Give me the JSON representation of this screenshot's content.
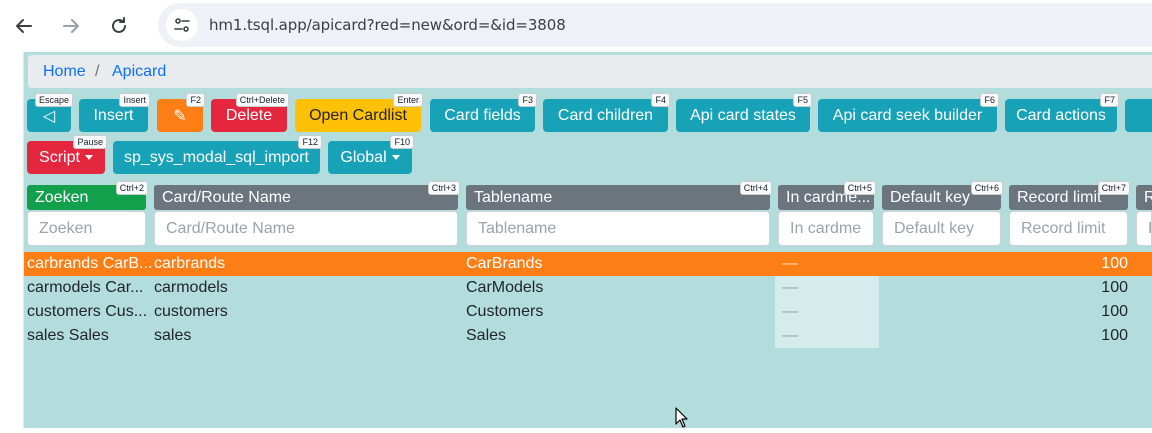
{
  "browser": {
    "url": "hm1.tsql.app/apicard?red=new&ord=&id=3808"
  },
  "breadcrumb": {
    "home": "Home",
    "separator": "/",
    "current": "Apicard"
  },
  "toolbar": {
    "back": {
      "label": "◁",
      "shortcut": "Escape"
    },
    "insert": {
      "label": "Insert",
      "shortcut": "Insert"
    },
    "edit": {
      "label": "✎",
      "shortcut": "F2"
    },
    "delete": {
      "label": "Delete",
      "shortcut": "Ctrl+Delete"
    },
    "open_cardlist": {
      "label": "Open Cardlist",
      "shortcut": "Enter"
    },
    "card_fields": {
      "label": "Card fields",
      "shortcut": "F3"
    },
    "card_children": {
      "label": "Card children",
      "shortcut": "F4"
    },
    "api_card_states": {
      "label": "Api card states",
      "shortcut": "F5"
    },
    "api_card_seek_builder": {
      "label": "Api card seek builder",
      "shortcut": "F6"
    },
    "card_actions": {
      "label": "Card actions",
      "shortcut": "F7"
    },
    "script": {
      "label": "Script",
      "shortcut": "Pause"
    },
    "sp_import": {
      "label": "sp_sys_modal_sql_import",
      "shortcut": "F12"
    },
    "global": {
      "label": "Global",
      "shortcut": "F10"
    }
  },
  "table": {
    "columns": [
      {
        "label": "Zoeken",
        "shortcut": "Ctrl+2",
        "placeholder": "Zoeken"
      },
      {
        "label": "Card/Route Name",
        "shortcut": "Ctrl+3",
        "placeholder": "Card/Route Name"
      },
      {
        "label": "Tablename",
        "shortcut": "Ctrl+4",
        "placeholder": "Tablename"
      },
      {
        "label": "In cardme...",
        "shortcut": "Ctrl+5",
        "placeholder": "In cardme"
      },
      {
        "label": "Default key",
        "shortcut": "Ctrl+6",
        "placeholder": "Default key"
      },
      {
        "label": "Record limit",
        "shortcut": "Ctrl+7",
        "placeholder": "Record limit"
      },
      {
        "label": "R",
        "shortcut": "",
        "placeholder": "R"
      }
    ],
    "rows": [
      {
        "search": "carbrands CarB...",
        "name": "carbrands",
        "table": "CarBrands",
        "in_cardmenu": "—",
        "limit": "100"
      },
      {
        "search": "carmodels Car...",
        "name": "carmodels",
        "table": "CarModels",
        "in_cardmenu": "—",
        "limit": "100"
      },
      {
        "search": "customers Cus...",
        "name": "customers",
        "table": "Customers",
        "in_cardmenu": "—",
        "limit": "100"
      },
      {
        "search": "sales Sales",
        "name": "sales",
        "table": "Sales",
        "in_cardmenu": "—",
        "limit": "100"
      }
    ]
  },
  "colors": {
    "background": "#b3dcdc",
    "teal": "#17a2b8",
    "selected_row": "#fd7e14",
    "search_header": "#12a04c",
    "header": "#6c757d"
  }
}
